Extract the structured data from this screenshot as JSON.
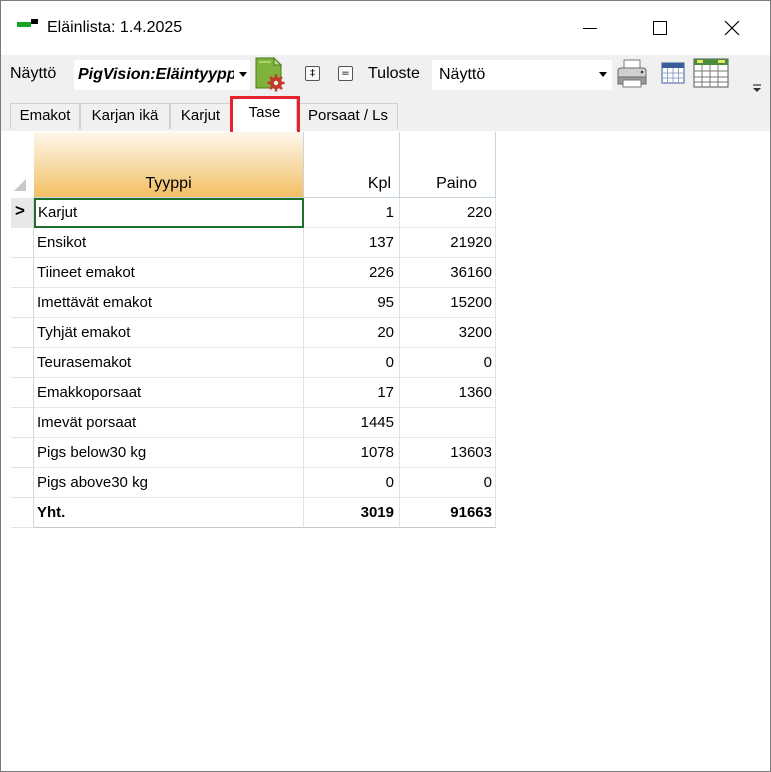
{
  "window": {
    "title": "Eläinlista: 1.4.2025",
    "controls": [
      "minimize",
      "maximize",
      "close"
    ]
  },
  "toolbar": {
    "view_label": "Näyttö",
    "view_value": "PigVision:Eläintyyppi",
    "print_label": "Tuloste",
    "print_value": "Näyttö",
    "expand_symbol": "‡",
    "collapse_symbol": "="
  },
  "tabs": [
    {
      "label": "Emakot",
      "active": false
    },
    {
      "label": "Karjan ikä",
      "active": false
    },
    {
      "label": "Karjut",
      "active": false
    },
    {
      "label": "Tase",
      "active": true
    },
    {
      "label": "Porsaat / Ls",
      "active": false
    }
  ],
  "grid": {
    "columns": {
      "type": "Tyyppi",
      "count": "Kpl",
      "weight": "Paino"
    },
    "current_row_marker": ">",
    "rows": [
      {
        "type": "Karjut",
        "count": "1",
        "weight": "220"
      },
      {
        "type": "Ensikot",
        "count": "137",
        "weight": "21920"
      },
      {
        "type": "Tiineet emakot",
        "count": "226",
        "weight": "36160"
      },
      {
        "type": "Imettävät emakot",
        "count": "95",
        "weight": "15200"
      },
      {
        "type": "Tyhjät emakot",
        "count": "20",
        "weight": "3200"
      },
      {
        "type": "Teurasemakot",
        "count": "0",
        "weight": "0"
      },
      {
        "type": "Emakkoporsaat",
        "count": "17",
        "weight": "1360"
      },
      {
        "type": "Imevät porsaat",
        "count": "1445",
        "weight": ""
      },
      {
        "type": "Pigs below30 kg",
        "count": "1078",
        "weight": "13603"
      },
      {
        "type": "Pigs above30 kg",
        "count": "0",
        "weight": "0"
      }
    ],
    "total": {
      "type": "Yht.",
      "count": "3019",
      "weight": "91663"
    }
  },
  "colors": {
    "highlight": "#e8232b",
    "header_sort": "#f4bf63",
    "selection_border": "#1e6f2c"
  }
}
